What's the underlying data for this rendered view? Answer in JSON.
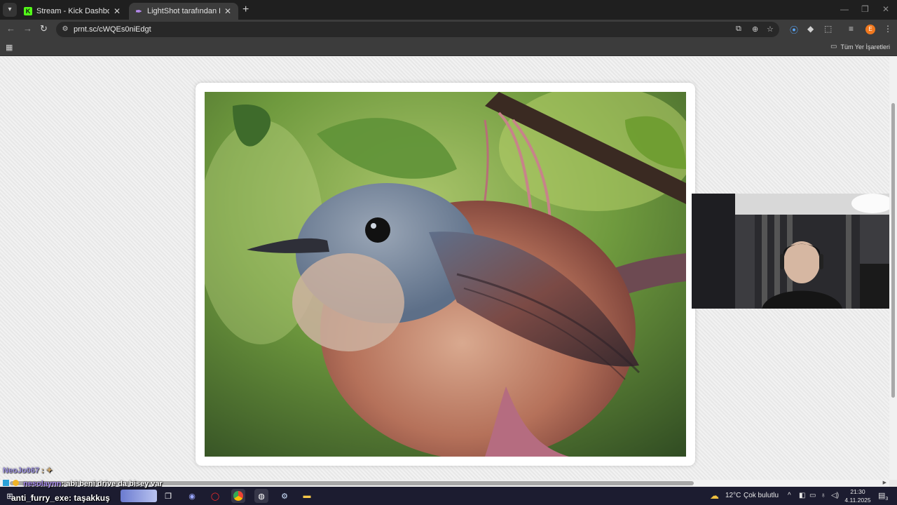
{
  "browser": {
    "tabs": [
      {
        "title": "Stream - Kick Dashboard",
        "favicon": "kick-logo-icon",
        "active": false
      },
      {
        "title": "LightShot tarafından Ekran Gör",
        "favicon": "lightshot-feather-icon",
        "active": true
      }
    ],
    "url": "prnt.sc/cWQEs0niEdgt",
    "profile_initial": "E",
    "bookmarks_folder": "Tüm Yer İşaretleri"
  },
  "chat": [
    {
      "user": "NeoJo067",
      "message": ""
    },
    {
      "user": "nesolaynn",
      "message": ": abi beni drive da bisey var"
    },
    {
      "user": "anti_furry_exe",
      "message": ": taşakkuş"
    }
  ],
  "taskbar": {
    "weather": {
      "temp": "12°C",
      "condition": "Çok bulutlu"
    },
    "time": "21:30",
    "date": "4.11.2025",
    "notification_count": "3"
  },
  "colors": {
    "kick_green": "#53fc18",
    "chat_username": "#a98cf0",
    "taskbar_bg": "#1c1c30"
  }
}
